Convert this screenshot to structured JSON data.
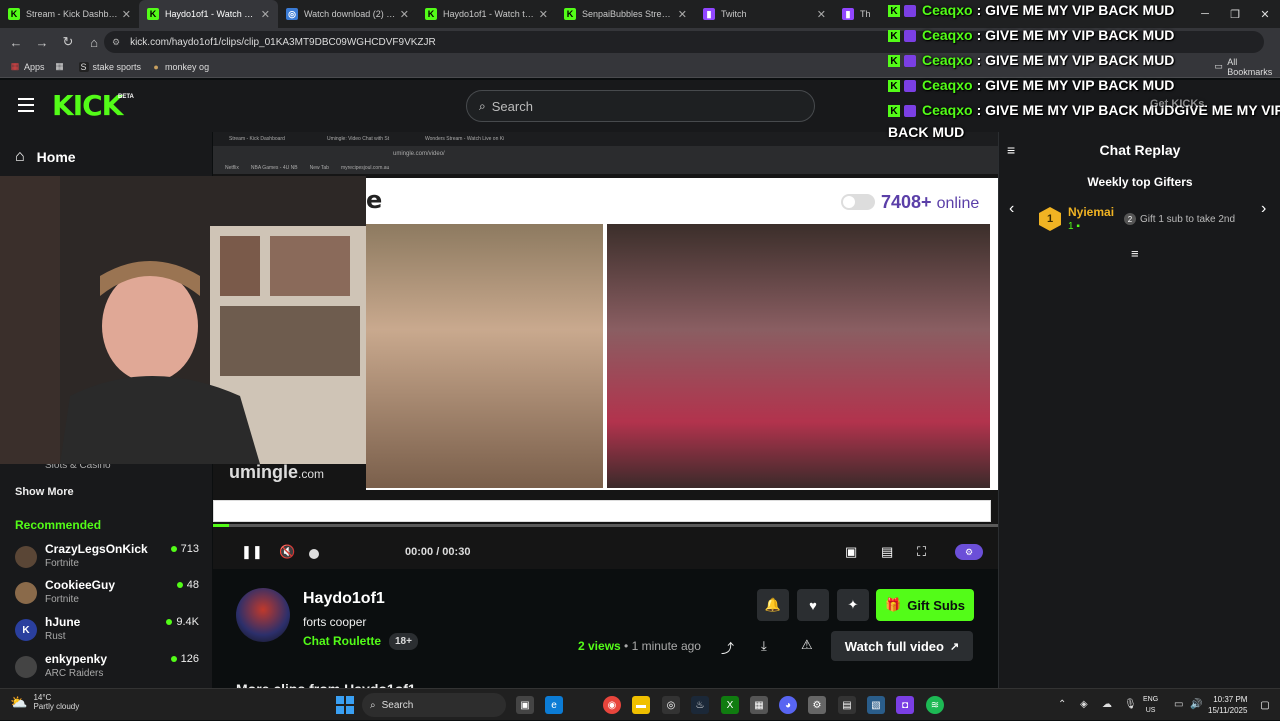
{
  "browser": {
    "tabs": [
      {
        "title": "Stream - Kick Dashboard",
        "fav_color": "#53fc18",
        "fav_glyph": "K",
        "active": false
      },
      {
        "title": "Haydo1of1 - Watch clips",
        "fav_color": "#53fc18",
        "fav_glyph": "K",
        "active": true
      },
      {
        "title": "Watch download (2) | Stre",
        "fav_color": "#3a7bd5",
        "fav_glyph": "◎",
        "active": false
      },
      {
        "title": "Haydo1of1 - Watch the V",
        "fav_color": "#53fc18",
        "fav_glyph": "K",
        "active": false
      },
      {
        "title": "SenpaiBubbles Stream - V",
        "fav_color": "#53fc18",
        "fav_glyph": "K",
        "active": false
      },
      {
        "title": "Twitch",
        "fav_color": "#9146ff",
        "fav_glyph": "▮",
        "active": false
      },
      {
        "title": "Th",
        "fav_color": "#9146ff",
        "fav_glyph": "▮",
        "active": false
      }
    ],
    "url": "kick.com/haydo1of1/clips/clip_01KA3MT9DBC09WGHCDVF9VKZJR",
    "bookmarks": [
      {
        "label": "Apps",
        "icon": "apps-grid-icon"
      },
      {
        "label": "",
        "icon": "grid-icon"
      },
      {
        "label": "stake sports",
        "icon": "stake-icon"
      },
      {
        "label": "monkey og",
        "icon": "monkey-icon"
      }
    ],
    "all_bookmarks": "All Bookmarks"
  },
  "header": {
    "logo": "KICK",
    "beta": "BETA",
    "search_placeholder": "Search"
  },
  "sidebar": {
    "home": "Home",
    "slots_label": "Slots & Casino",
    "show_more": "Show More",
    "recommended_title": "Recommended",
    "recommended": [
      {
        "name": "CrazyLegsOnKick",
        "game": "Fortnite",
        "viewers": "713",
        "avatar_color": "#5a4636",
        "initial": ""
      },
      {
        "name": "CookieeGuy",
        "game": "Fortnite",
        "viewers": "48",
        "avatar_color": "#8a6a4a",
        "initial": ""
      },
      {
        "name": "hJune",
        "game": "Rust",
        "viewers": "9.4K",
        "avatar_color": "#2a3f9e",
        "initial": "K"
      },
      {
        "name": "enkypenky",
        "game": "ARC Raiders",
        "viewers": "126",
        "avatar_color": "#444",
        "initial": ""
      }
    ]
  },
  "video": {
    "inner_tabs": [
      "Stream - Kick Dashboard",
      "Umingle: Video Chat with St",
      "Wonders Stream - Watch Live on Ki"
    ],
    "inner_url": "umingle.com/video/",
    "inner_bookmarks": [
      "Netflix",
      "NBA Games - 4U NB",
      "New Tab",
      "myrecipesjoul.com.au"
    ],
    "um_e": "e",
    "um_online_count": "7408+",
    "um_online_label": "online",
    "um_logo": "umingle",
    "um_logo_suffix": ".com",
    "time": "00:00 / 00:30",
    "progress": 0.02
  },
  "clip": {
    "channel": "Haydo1of1",
    "title": "forts cooper",
    "category": "Chat Roulette",
    "age_badge": "18+",
    "views_count": "2 views",
    "posted": "• 1 minute ago",
    "gift_label": "Gift Subs",
    "full_video_label": "Watch full video",
    "more_clips": "More clips from Haydo1of1"
  },
  "chat": {
    "title": "Chat Replay",
    "gifters_title": "Weekly top Gifters",
    "top_gifter": {
      "rank": "1",
      "name": "Nyiemai",
      "count": "1"
    },
    "second_hint": "Gift 1 sub to take 2nd",
    "second_rank": "2"
  },
  "overlay_chat": [
    {
      "user": "Ceaqxo",
      "msg": ": GIVE ME MY VIP BACK MUD"
    },
    {
      "user": "Ceaqxo",
      "msg": ": GIVE ME MY VIP BACK MUD"
    },
    {
      "user": "Ceaqxo",
      "msg": ": GIVE ME MY VIP BACK MUD"
    },
    {
      "user": "Ceaqxo",
      "msg": ": GIVE ME MY VIP BACK MUD"
    },
    {
      "user": "Ceaqxo",
      "msg": ": GIVE ME MY VIP BACK MUDGIVE ME MY VIP"
    },
    {
      "user": "",
      "msg": "BACK MUD"
    }
  ],
  "overlay_partial": "Get KICKs",
  "taskbar": {
    "temp": "14°C",
    "weather": "Partly cloudy",
    "search": "Search",
    "lang_1": "ENG",
    "lang_2": "US",
    "time": "10:37 PM",
    "date": "15/11/2025"
  }
}
